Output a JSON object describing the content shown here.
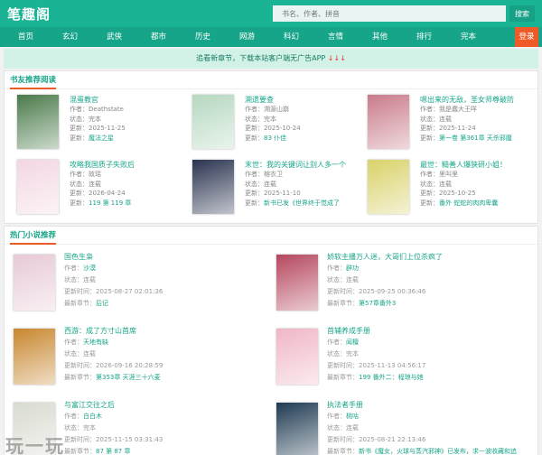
{
  "site": {
    "logo": "笔趣阁"
  },
  "search": {
    "placeholder": "书名、作者、拼音",
    "button": "搜索"
  },
  "nav": {
    "items": [
      "首页",
      "玄幻",
      "武侠",
      "都市",
      "历史",
      "网游",
      "科幻",
      "言情",
      "其他",
      "排行",
      "完本"
    ],
    "login": "登录"
  },
  "notice": {
    "text": "追看新章节，下载本站客户端无广告APP",
    "arrows": "↓↓↓"
  },
  "labels": {
    "author": "作者：",
    "status": "状态：",
    "update": "更新：",
    "update_time": "更新时间：",
    "latest": "最新章节："
  },
  "recommend": {
    "title": "书友推荐阅读",
    "items": [
      {
        "title": "混蛋教官",
        "author": "Deathstate",
        "status": "完本",
        "update": "2025-11-25",
        "latest": "魔法之星",
        "color": "#4a7a4a"
      },
      {
        "title": "溯遗要查",
        "author": "溯源山崩",
        "status": "完本",
        "update": "2025-10-24",
        "latest": "83 仆佳",
        "color": "#b5d8c0"
      },
      {
        "title": "嗯出来的无敌，圣女师尊破防",
        "author": "我是蠢大王咩",
        "status": "连载",
        "update": "2025-11-24",
        "latest": "第一卷 第361章 天杀邪魔",
        "color": "#c97b8a"
      },
      {
        "title": "攻略我国质子失败后",
        "author": "故瑶",
        "status": "连载",
        "update": "2026-04-24",
        "latest": "119 第 119 章",
        "color": "#f3d6e2"
      },
      {
        "title": "末世：我的关键词让别人多一个",
        "author": "榕衣卫",
        "status": "连载",
        "update": "2025-11-10",
        "latest": "新书已发《世界终于觉成了",
        "color": "#2a3350"
      },
      {
        "title": "最世：糙善人爆狭研小姐！",
        "author": "里叫里",
        "status": "连载",
        "update": "2025-10-25",
        "latest": "番外 蛇蛇的肉肉卑囊",
        "color": "#d9d26a"
      }
    ]
  },
  "hot": {
    "title": "热门小说推荐",
    "items": [
      {
        "title": "国色生枭",
        "author": "沙漠",
        "status": "连载",
        "update": "2025-08-27 02:01:36",
        "latest": "后记",
        "color": "#e7c9d6"
      },
      {
        "title": "娇软主播万人迷，大哥们上位杀疯了",
        "author": "辟功",
        "status": "连载",
        "update": "2025-09-25 00:36:46",
        "latest": "第57章番外3",
        "color": "#b5475e"
      },
      {
        "title": "西游：成了方寸山首席",
        "author": "天地有缺",
        "status": "连载",
        "update": "2026-09-16 20:28:59",
        "latest": "第353章 天涯三十六麦",
        "color": "#c8872f"
      },
      {
        "title": "首辅养成手册",
        "author": "闻檀",
        "status": "完本",
        "update": "2025-11-13 04:56:17",
        "latest": "199 番外二：程琅与她",
        "color": "#f0b6c6"
      },
      {
        "title": "与富江交往之后",
        "author": "白白木",
        "status": "完本",
        "update": "2025-11-15 03:31:43",
        "latest": "87 第 87 章",
        "color": "#d8dbd0"
      },
      {
        "title": "执法者手册",
        "author": "桃咕",
        "status": "连载",
        "update": "2025-08-21 22:13:46",
        "latest": "新书《魔女，火球与蒸汽邪神》已发布，求一波收藏和追",
        "color": "#1f3a52"
      }
    ]
  },
  "watermark": "玩一玩"
}
